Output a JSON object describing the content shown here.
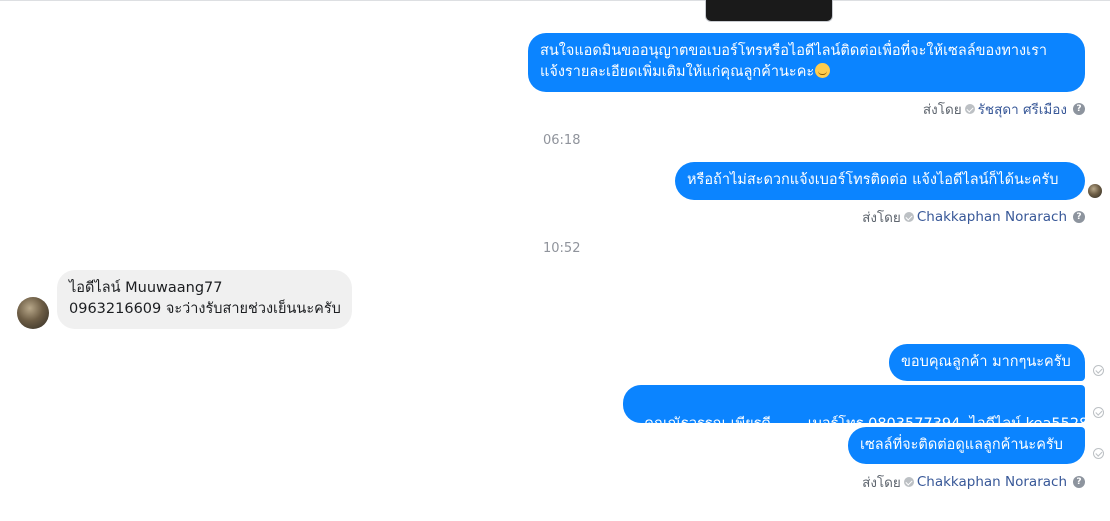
{
  "messages": [
    {
      "id": "m1",
      "line1": "สนใจแอดมินขออนุญาตขอเบอร์โทรหรือไอดีไลน์ติดต่อเพื่อที่จะให้เซลล์ของทางเรา",
      "line2": "แจ้งรายละเอียดเพิ่มเติมให้แก่คุณลูกค้านะคะ"
    },
    {
      "id": "m2",
      "text": "หรือถ้าไม่สะดวกแจ้งเบอร์โทรติดต่อ แจ้งไอดีไลน์ก็ได้นะครับ"
    },
    {
      "id": "m3",
      "line1": "ไอดีไลน์ Muuwaang77",
      "line2": "0963216609 จะว่างรับสายช่วงเย็นนะครับ"
    },
    {
      "id": "m4",
      "text": "ขอบคุณลูกค้า มากๆนะครับ"
    },
    {
      "id": "m5",
      "text": "คุณณัฐวรรณ เพียรดี        เบอร์โทร 0803577394  ไอดีไลน์ kea5528"
    },
    {
      "id": "m6",
      "text": "เซลล์ที่จะติดต่อดูแลลูกค้านะครับ"
    }
  ],
  "sent_by_label": "ส่งโดย",
  "senders": {
    "s1": "รัชสุดา ศรีเมือง",
    "s2": "Chakkaphan Norarach",
    "s3": "Chakkaphan Norarach"
  },
  "timestamps": {
    "t1": "06:18",
    "t2": "10:52"
  },
  "help_glyph": "?",
  "colors": {
    "outgoing_bubble": "#0b84ff",
    "incoming_bubble": "#f0f0f0"
  }
}
